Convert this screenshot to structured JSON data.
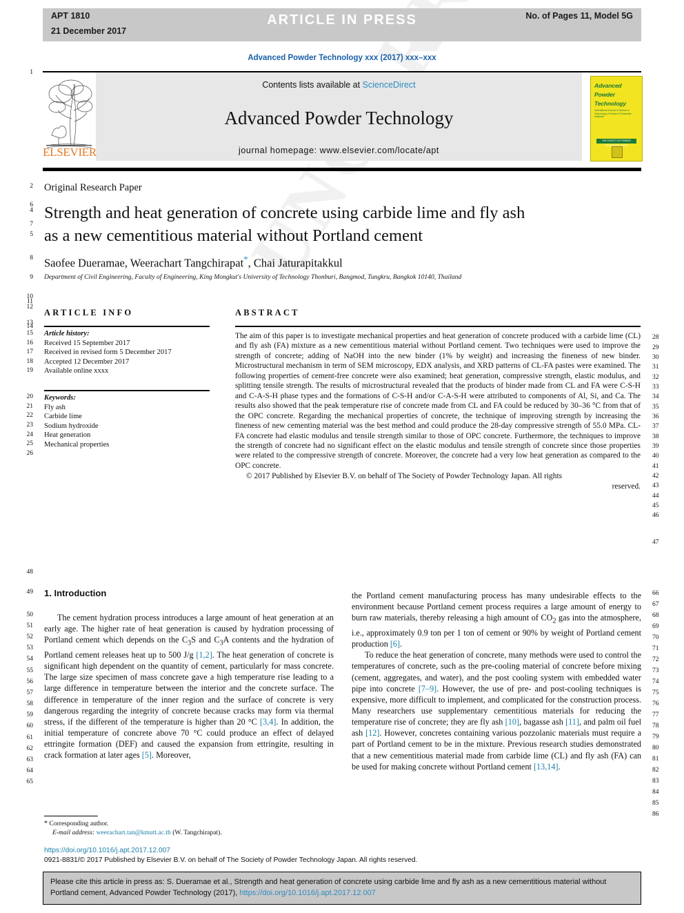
{
  "header": {
    "apt_code": "APT 1810",
    "apt_date": "21 December 2017",
    "banner_text": "ARTICLE  IN  PRESS",
    "pages_model": "No. of Pages 11, Model 5G"
  },
  "journal_ref": "Advanced Powder Technology xxx (2017) xxx–xxx",
  "masthead": {
    "contents_prefix": "Contents lists available at ",
    "sciencedirect": "ScienceDirect",
    "journal_title": "Advanced Powder Technology",
    "homepage": "journal homepage: www.elsevier.com/locate/apt",
    "publisher": "ELSEVIER",
    "cover": {
      "line1": "Advanced",
      "line2": "Powder",
      "line3": "Technology",
      "subtitle": "International Journal of Science & Technology of Powder & Particulate Materials",
      "bar_text": "THE SOCIETY OF POWDER TECHNOLOGY JAPAN"
    }
  },
  "article": {
    "type": "Original Research Paper",
    "title_line1": "Strength and heat generation of concrete using carbide lime and fly ash",
    "title_line2": "as a new cementitious material without Portland cement",
    "authors_pre": "Saofee Dueramae, Weerachart Tangchirapat",
    "authors_post": ", Chai Jaturapitakkul",
    "corresponding_marker": "*",
    "affiliation": "Department of Civil Engineering, Faculty of Engineering, King Mongkut's University of Technology Thonburi, Bangmod, Tungkru, Bangkok 10140, Thailand"
  },
  "article_info": {
    "heading": "ARTICLE INFO",
    "history_label": "Article history:",
    "history": [
      "Received 15 September 2017",
      "Received in revised form 5 December 2017",
      "Accepted 12 December 2017",
      "Available online xxxx"
    ],
    "keywords_label": "Keywords:",
    "keywords": [
      "Fly ash",
      "Carbide lime",
      "Sodium hydroxide",
      "Heat generation",
      "Mechanical properties"
    ]
  },
  "abstract": {
    "heading": "ABSTRACT",
    "body": "The aim of this paper is to investigate mechanical properties and heat generation of concrete produced with a carbide lime (CL) and fly ash (FA) mixture as a new cementitious material without Portland cement. Two techniques were used to improve the strength of concrete; adding of NaOH into the new binder (1% by weight) and increasing the fineness of new binder. Microstructural mechanism in term of SEM microscopy, EDX analysis, and XRD patterns of CL-FA pastes were examined. The following properties of cement-free concrete were also examined; heat generation, compressive strength, elastic modulus, and splitting tensile strength. The results of microstructural revealed that the products of binder made from CL and FA were C-S-H and C-A-S-H phase types and the formations of C-S-H and/or C-A-S-H were attributed to components of Al, Si, and Ca. The results also showed that the peak temperature rise of concrete made from CL and FA could be reduced by 30–36 °C from that of the OPC concrete. Regarding the mechanical properties of concrete, the technique of improving strength by increasing the fineness of new cementing material was the best method and could produce the 28-day compressive strength of 55.0 MPa. CL-FA concrete had elastic modulus and tensile strength similar to those of OPC concrete. Furthermore, the techniques to improve the strength of concrete had no significant effect on the elastic modulus and tensile strength of concrete since those properties were related to the compressive strength of concrete. Moreover, the concrete had a very low heat generation as compared to the OPC concrete.",
    "copyright": "© 2017 Published by Elsevier B.V. on behalf of The Society of Powder Technology Japan. All rights",
    "reserved": "reserved."
  },
  "introduction": {
    "heading": "1. Introduction",
    "left_paragraph_1": "The cement hydration process introduces a large amount of heat generation at an early age. The higher rate of heat generation is caused by hydration processing of Portland cement which depends on the C3S and C3A contents and the hydration of Portland cement releases heat up to 500 J/g [1,2]. The heat generation of concrete is significant high dependent on the quantity of cement, particularly for mass concrete. The large size specimen of mass concrete gave a high temperature rise leading to a large difference in temperature between the interior and the concrete surface. The difference in temperature of the inner region and the surface of concrete is very dangerous regarding the integrity of concrete because cracks may form via thermal stress, if the different of the temperature is higher than 20 °C [3,4]. In addition, the initial temperature of concrete above 70 °C could produce an effect of delayed ettringite formation (DEF) and caused the expansion from ettringite, resulting in crack formation at later ages [5]. Moreover,",
    "right_paragraph_1": "the Portland cement manufacturing process has many undesirable effects to the environment because Portland cement process requires a large amount of energy to burn raw materials, thereby releasing a high amount of CO2 gas into the atmosphere, i.e., approximately 0.9 ton per 1 ton of cement or 90% by weight of Portland cement production [6].",
    "right_paragraph_2": "To reduce the heat generation of concrete, many methods were used to control the temperatures of concrete, such as the pre-cooling material of concrete before mixing (cement, aggregates, and water), and the post cooling system with embedded water pipe into concrete [7–9]. However, the use of pre- and post-cooling techniques is expensive, more difficult to implement, and complicated for the construction process. Many researchers use supplementary cementitious materials for reducing the temperature rise of concrete; they are fly ash [10], bagasse ash [11], and palm oil fuel ash [12]. However, concretes containing various pozzolanic materials must require a part of Portland cement to be in the mixture. Previous research studies demonstrated that a new cementitious material made from carbide lime (CL) and fly ash (FA) can be used for making concrete without Portland cement [13,14]."
  },
  "footer": {
    "corresponding_marker": "*",
    "corresponding_label": "Corresponding author.",
    "email_label": "E-mail address:",
    "email": "weerachart.tan@kmutt.ac.th",
    "email_owner": "(W. Tangchirapat).",
    "doi": "https://doi.org/10.1016/j.apt.2017.12.007",
    "issn_line": "0921-8831/© 2017 Published by Elsevier B.V. on behalf of The Society of Powder Technology Japan. All rights reserved."
  },
  "cite_box": {
    "text": "Please cite this article in press as: S. Dueramae et al., Strength and heat generation of concrete using carbide lime and fly ash as a new cementitious material without Portland cement, Advanced Powder Technology (2017), ",
    "doi": "https://doi.org/10.1016/j.apt.2017.12.007"
  },
  "line_numbers": {
    "left": [
      "1",
      "2",
      "6",
      "4",
      "7",
      "5",
      "8",
      "9",
      "10",
      "11",
      "12",
      "13",
      "14",
      "15",
      "16",
      "17",
      "18",
      "19",
      "20",
      "21",
      "22",
      "23",
      "24",
      "25",
      "26",
      "48",
      "49",
      "50",
      "51",
      "52",
      "53",
      "54",
      "55",
      "56",
      "57",
      "58",
      "59",
      "60",
      "61",
      "62",
      "63",
      "64",
      "65"
    ],
    "right": [
      "28",
      "29",
      "30",
      "31",
      "32",
      "33",
      "34",
      "35",
      "36",
      "37",
      "38",
      "39",
      "40",
      "41",
      "42",
      "43",
      "44",
      "45",
      "46",
      "47",
      "66",
      "67",
      "68",
      "69",
      "70",
      "71",
      "72",
      "73",
      "74",
      "75",
      "76",
      "77",
      "78",
      "79",
      "80",
      "81",
      "82",
      "83",
      "84",
      "85",
      "86"
    ]
  },
  "watermark": "UNCORRECTED PROOF"
}
